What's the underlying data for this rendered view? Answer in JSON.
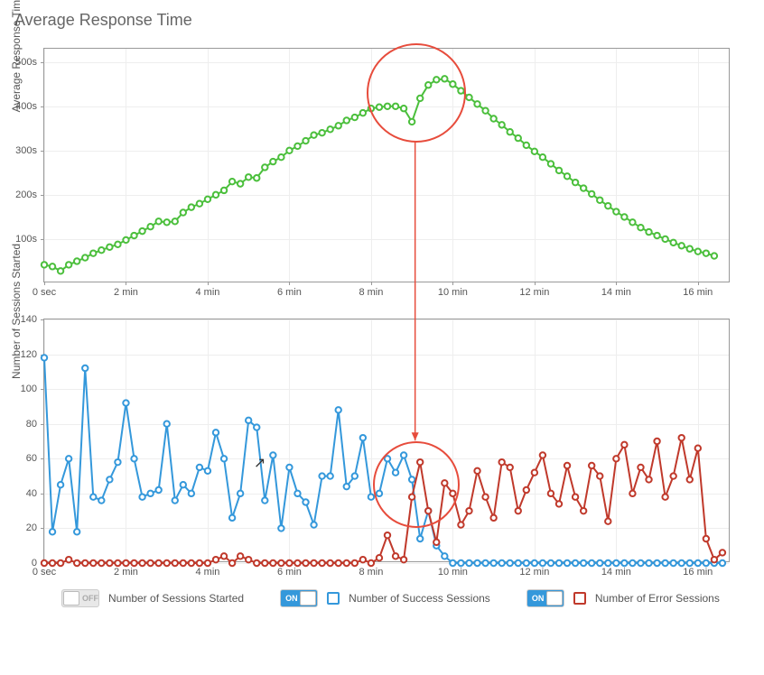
{
  "title": "Average Response Time",
  "chart_data": [
    {
      "type": "line",
      "title": "Average Response Time",
      "xlabel": "",
      "ylabel": "Average Response Time",
      "ylim": [
        0,
        530
      ],
      "yticks": [
        {
          "v": 100,
          "l": "100s"
        },
        {
          "v": 200,
          "l": "200s"
        },
        {
          "v": 300,
          "l": "300s"
        },
        {
          "v": 400,
          "l": "400s"
        },
        {
          "v": 500,
          "l": "500s"
        }
      ],
      "xlim": [
        0,
        16.8
      ],
      "xticks": [
        {
          "v": 0,
          "l": "0 sec"
        },
        {
          "v": 2,
          "l": "2 min"
        },
        {
          "v": 4,
          "l": "4 min"
        },
        {
          "v": 6,
          "l": "6 min"
        },
        {
          "v": 8,
          "l": "8 min"
        },
        {
          "v": 10,
          "l": "10 min"
        },
        {
          "v": 12,
          "l": "12 min"
        },
        {
          "v": 14,
          "l": "14 min"
        },
        {
          "v": 16,
          "l": "16 min"
        }
      ],
      "series": [
        {
          "name": "Average Response Time",
          "color": "#4bbf3c",
          "x": [
            0,
            0.2,
            0.4,
            0.6,
            0.8,
            1,
            1.2,
            1.4,
            1.6,
            1.8,
            2,
            2.2,
            2.4,
            2.6,
            2.8,
            3,
            3.2,
            3.4,
            3.6,
            3.8,
            4,
            4.2,
            4.4,
            4.6,
            4.8,
            5,
            5.2,
            5.4,
            5.6,
            5.8,
            6,
            6.2,
            6.4,
            6.6,
            6.8,
            7,
            7.2,
            7.4,
            7.6,
            7.8,
            8,
            8.2,
            8.4,
            8.6,
            8.8,
            9,
            9.2,
            9.4,
            9.6,
            9.8,
            10,
            10.2,
            10.4,
            10.6,
            10.8,
            11,
            11.2,
            11.4,
            11.6,
            11.8,
            12,
            12.2,
            12.4,
            12.6,
            12.8,
            13,
            13.2,
            13.4,
            13.6,
            13.8,
            14,
            14.2,
            14.4,
            14.6,
            14.8,
            15,
            15.2,
            15.4,
            15.6,
            15.8,
            16,
            16.2,
            16.4
          ],
          "values": [
            42,
            38,
            28,
            42,
            50,
            58,
            68,
            75,
            82,
            88,
            98,
            108,
            118,
            128,
            140,
            138,
            140,
            160,
            172,
            180,
            190,
            200,
            210,
            230,
            225,
            240,
            238,
            262,
            275,
            285,
            300,
            310,
            322,
            335,
            340,
            348,
            356,
            368,
            375,
            385,
            395,
            398,
            400,
            400,
            395,
            365,
            418,
            448,
            460,
            462,
            450,
            435,
            420,
            405,
            390,
            372,
            358,
            342,
            328,
            312,
            298,
            285,
            270,
            255,
            242,
            228,
            215,
            202,
            188,
            175,
            162,
            150,
            138,
            126,
            116,
            108,
            100,
            92,
            85,
            78,
            72,
            68,
            62
          ]
        }
      ]
    },
    {
      "type": "line",
      "title": "Number of Sessions Started",
      "xlabel": "",
      "ylabel": "Number of Sessions Started",
      "ylim": [
        0,
        140
      ],
      "yticks": [
        {
          "v": 0,
          "l": "0"
        },
        {
          "v": 20,
          "l": "20"
        },
        {
          "v": 40,
          "l": "40"
        },
        {
          "v": 60,
          "l": "60"
        },
        {
          "v": 80,
          "l": "80"
        },
        {
          "v": 100,
          "l": "100"
        },
        {
          "v": 120,
          "l": "120"
        },
        {
          "v": 140,
          "l": "140"
        }
      ],
      "xlim": [
        0,
        16.8
      ],
      "xticks": [
        {
          "v": 0,
          "l": "0 sec"
        },
        {
          "v": 2,
          "l": "2 min"
        },
        {
          "v": 4,
          "l": "4 min"
        },
        {
          "v": 6,
          "l": "6 min"
        },
        {
          "v": 8,
          "l": "8 min"
        },
        {
          "v": 10,
          "l": "10 min"
        },
        {
          "v": 12,
          "l": "12 min"
        },
        {
          "v": 14,
          "l": "14 min"
        },
        {
          "v": 16,
          "l": "16 min"
        }
      ],
      "series": [
        {
          "name": "Number of Success Sessions",
          "color": "#3498db",
          "x": [
            0,
            0.2,
            0.4,
            0.6,
            0.8,
            1,
            1.2,
            1.4,
            1.6,
            1.8,
            2,
            2.2,
            2.4,
            2.6,
            2.8,
            3,
            3.2,
            3.4,
            3.6,
            3.8,
            4,
            4.2,
            4.4,
            4.6,
            4.8,
            5,
            5.2,
            5.4,
            5.6,
            5.8,
            6,
            6.2,
            6.4,
            6.6,
            6.8,
            7,
            7.2,
            7.4,
            7.6,
            7.8,
            8,
            8.2,
            8.4,
            8.6,
            8.8,
            9,
            9.2,
            9.4,
            9.6,
            9.8,
            10,
            10.2,
            10.4,
            10.6,
            10.8,
            11,
            11.2,
            11.4,
            11.6,
            11.8,
            12,
            12.2,
            12.4,
            12.6,
            12.8,
            13,
            13.2,
            13.4,
            13.6,
            13.8,
            14,
            14.2,
            14.4,
            14.6,
            14.8,
            15,
            15.2,
            15.4,
            15.6,
            15.8,
            16,
            16.2,
            16.4,
            16.6
          ],
          "values": [
            118,
            18,
            45,
            60,
            18,
            112,
            38,
            36,
            48,
            58,
            92,
            60,
            38,
            40,
            42,
            80,
            36,
            45,
            40,
            55,
            53,
            75,
            60,
            26,
            40,
            82,
            78,
            36,
            62,
            20,
            55,
            40,
            35,
            22,
            50,
            50,
            88,
            44,
            50,
            72,
            38,
            40,
            60,
            52,
            62,
            48,
            14,
            30,
            10,
            4,
            0,
            0,
            0,
            0,
            0,
            0,
            0,
            0,
            0,
            0,
            0,
            0,
            0,
            0,
            0,
            0,
            0,
            0,
            0,
            0,
            0,
            0,
            0,
            0,
            0,
            0,
            0,
            0,
            0,
            0,
            0,
            0,
            0,
            0
          ]
        },
        {
          "name": "Number of Error Sessions",
          "color": "#c0392b",
          "x": [
            0,
            0.2,
            0.4,
            0.6,
            0.8,
            1,
            1.2,
            1.4,
            1.6,
            1.8,
            2,
            2.2,
            2.4,
            2.6,
            2.8,
            3,
            3.2,
            3.4,
            3.6,
            3.8,
            4,
            4.2,
            4.4,
            4.6,
            4.8,
            5,
            5.2,
            5.4,
            5.6,
            5.8,
            6,
            6.2,
            6.4,
            6.6,
            6.8,
            7,
            7.2,
            7.4,
            7.6,
            7.8,
            8,
            8.2,
            8.4,
            8.6,
            8.8,
            9,
            9.2,
            9.4,
            9.6,
            9.8,
            10,
            10.2,
            10.4,
            10.6,
            10.8,
            11,
            11.2,
            11.4,
            11.6,
            11.8,
            12,
            12.2,
            12.4,
            12.6,
            12.8,
            13,
            13.2,
            13.4,
            13.6,
            13.8,
            14,
            14.2,
            14.4,
            14.6,
            14.8,
            15,
            15.2,
            15.4,
            15.6,
            15.8,
            16,
            16.2,
            16.4,
            16.6
          ],
          "values": [
            0,
            0,
            0,
            2,
            0,
            0,
            0,
            0,
            0,
            0,
            0,
            0,
            0,
            0,
            0,
            0,
            0,
            0,
            0,
            0,
            0,
            2,
            4,
            0,
            4,
            2,
            0,
            0,
            0,
            0,
            0,
            0,
            0,
            0,
            0,
            0,
            0,
            0,
            0,
            2,
            0,
            3,
            16,
            4,
            2,
            38,
            58,
            30,
            12,
            46,
            40,
            22,
            30,
            53,
            38,
            26,
            58,
            55,
            30,
            42,
            52,
            62,
            40,
            34,
            56,
            38,
            30,
            56,
            50,
            24,
            60,
            68,
            40,
            55,
            48,
            70,
            38,
            50,
            72,
            48,
            66,
            14,
            2,
            6
          ]
        }
      ]
    }
  ],
  "legend": {
    "items": [
      {
        "label": "Number of Sessions Started",
        "on": false,
        "color": "#888888"
      },
      {
        "label": "Number of Success Sessions",
        "on": true,
        "color": "#3498db"
      },
      {
        "label": "Number of Error Sessions",
        "on": true,
        "color": "#c0392b"
      }
    ],
    "on_text": "ON",
    "off_text": "OFF"
  },
  "annotations": {
    "circle_top": {
      "cx": 9.1,
      "cy": 430,
      "r": 55
    },
    "circle_bottom": {
      "cx": 9.1,
      "cy": 45,
      "r": 48
    },
    "arrow": true
  }
}
